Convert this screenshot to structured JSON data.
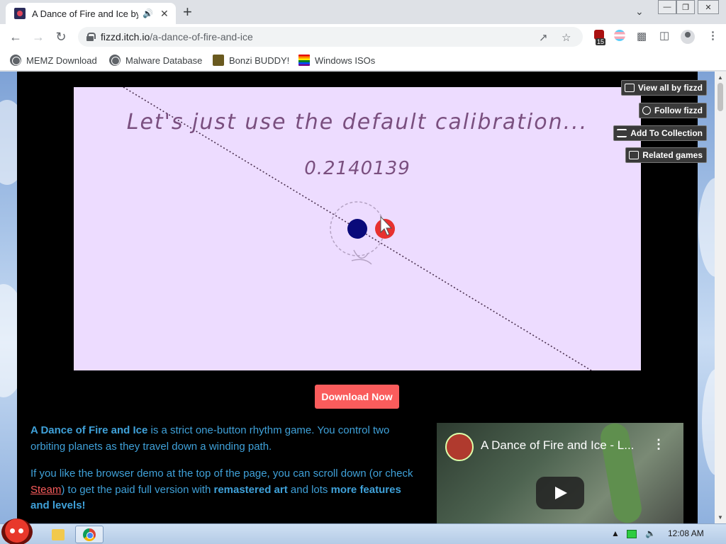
{
  "browser": {
    "tab": {
      "title": "A Dance of Fire and Ice by fizzd",
      "audio_icon": "speaker-icon",
      "close": "✕"
    },
    "new_tab": "+",
    "url": {
      "host": "fizzd.itch.io",
      "path": "/a-dance-of-fire-and-ice"
    },
    "extension_badge_count": "15",
    "bookmarks": [
      {
        "label": "MEMZ Download",
        "icon": "globe-icon"
      },
      {
        "label": "Malware Database",
        "icon": "globe-icon"
      },
      {
        "label": "Bonzi BUDDY!",
        "icon": "bonzi-icon"
      },
      {
        "label": "Windows ISOs",
        "icon": "rainbow-flag-icon"
      }
    ]
  },
  "game": {
    "calibration_text": "Let's just use the default calibration...",
    "calibration_value": "0.2140139",
    "planet_colors": {
      "ice": "#0a0a7a",
      "fire": "#e8312f"
    }
  },
  "side_buttons": [
    {
      "label": "View all by fizzd",
      "icon": "games-icon"
    },
    {
      "label": "Follow fizzd",
      "icon": "follow-icon"
    },
    {
      "label": "Add To Collection",
      "icon": "collection-icon"
    },
    {
      "label": "Related games",
      "icon": "map-icon"
    }
  ],
  "download_button": "Download Now",
  "description": {
    "p1_bold": "A Dance of Fire and Ice",
    "p1_rest": " is a strict one-button rhythm game. You control two orbiting planets as they travel down a winding path.",
    "p2_a": "If you like the browser demo at the top of the page, you can scroll down (or check ",
    "p2_link": "Steam",
    "p2_b": ") to get the paid full version with ",
    "p2_bold1": "remastered art",
    "p2_c": " and lots ",
    "p2_bold2": "more features and levels",
    "p2_d": "!"
  },
  "video": {
    "title": "A Dance of Fire and Ice - L...",
    "menu": "⋮"
  },
  "taskbar": {
    "clock": "12:08 AM"
  },
  "colors": {
    "accent": "#fa5c5c",
    "text_link": "#3fa1d9",
    "game_bg": "#eddcff"
  }
}
